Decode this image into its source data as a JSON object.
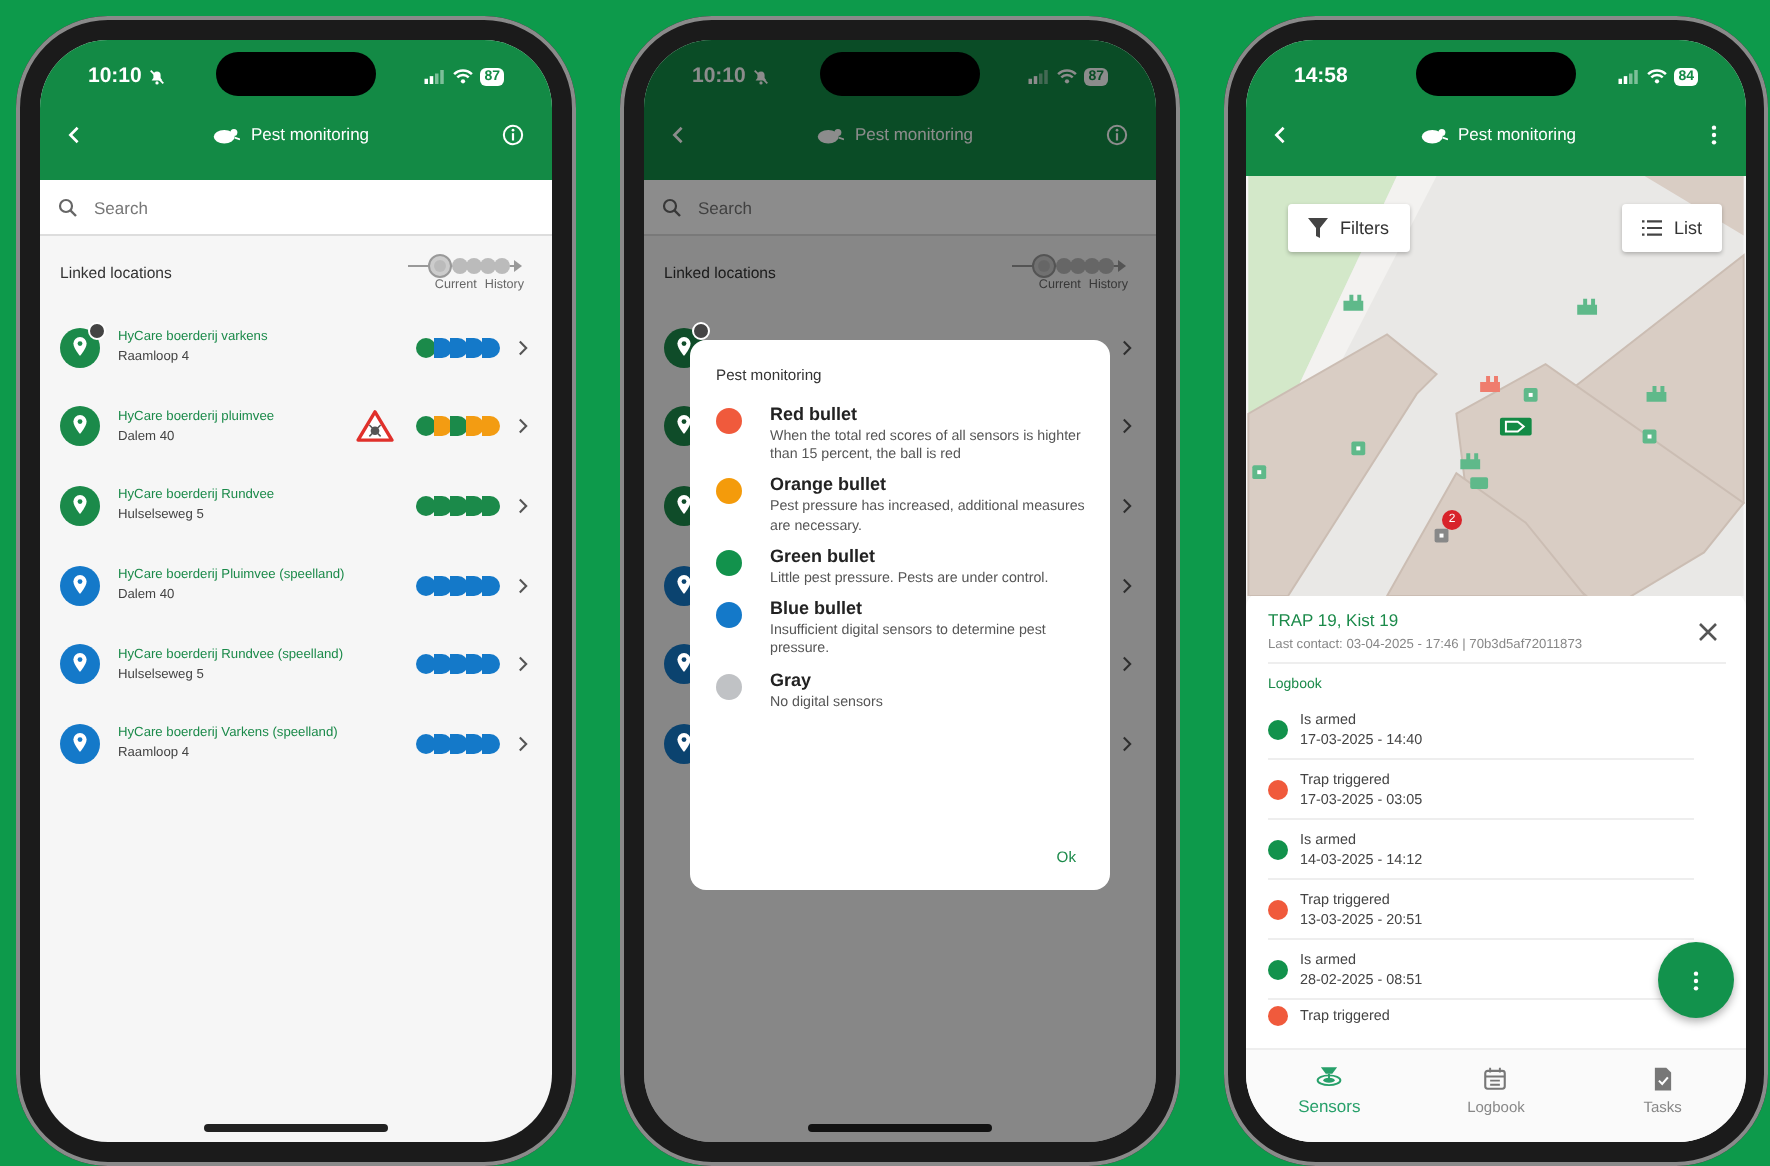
{
  "phones": [
    {
      "kind": "list",
      "status": {
        "time": "10:10",
        "silent": true,
        "battery": "87"
      },
      "header": {
        "title": "Pest monitoring",
        "kind": "info"
      },
      "search": {
        "placeholder": "Search"
      },
      "section": {
        "title": "Linked locations",
        "legend": [
          "Current",
          "History"
        ]
      },
      "locations": [
        {
          "name": "HyCare boerderij varkens",
          "address": "Raamloop 4",
          "color": "#1b8a4a",
          "badge": true,
          "warning": false,
          "bullets": [
            {
              "color": "#1b8a4a"
            },
            {
              "color": "#1479c9"
            },
            {
              "color": "#1479c9"
            },
            {
              "color": "#1479c9"
            },
            {
              "color": "#1479c9"
            }
          ]
        },
        {
          "name": "HyCare boerderij pluimvee",
          "address": "Dalem 40",
          "color": "#1b8a4a",
          "badge": false,
          "warning": true,
          "bullets": [
            {
              "color": "#1b8a4a"
            },
            {
              "color": "#f39c12"
            },
            {
              "color": "#1b8a4a"
            },
            {
              "color": "#f39c12"
            },
            {
              "color": "#f39c12"
            }
          ]
        },
        {
          "name": "HyCare boerderij Rundvee",
          "address": "Hulselseweg 5",
          "color": "#1b8a4a",
          "badge": false,
          "warning": false,
          "bullets": [
            {
              "color": "#1b8a4a"
            },
            {
              "color": "#1b8a4a"
            },
            {
              "color": "#1b8a4a"
            },
            {
              "color": "#1b8a4a"
            },
            {
              "color": "#1b8a4a"
            }
          ]
        },
        {
          "name": "HyCare boerderij Pluimvee (speelland)",
          "address": "Dalem 40",
          "color": "#1479c9",
          "badge": false,
          "warning": false,
          "bullets": [
            {
              "color": "#1479c9"
            },
            {
              "color": "#1479c9"
            },
            {
              "color": "#1479c9"
            },
            {
              "color": "#1479c9"
            },
            {
              "color": "#1479c9"
            }
          ]
        },
        {
          "name": "HyCare boerderij Rundvee (speelland)",
          "address": "Hulselseweg 5",
          "color": "#1479c9",
          "badge": false,
          "warning": false,
          "bullets": [
            {
              "color": "#1479c9"
            },
            {
              "color": "#1479c9"
            },
            {
              "color": "#1479c9"
            },
            {
              "color": "#1479c9"
            },
            {
              "color": "#1479c9"
            }
          ]
        },
        {
          "name": "HyCare boerderij Varkens (speelland)",
          "address": "Raamloop 4",
          "color": "#1479c9",
          "badge": false,
          "warning": false,
          "bullets": [
            {
              "color": "#1479c9"
            },
            {
              "color": "#1479c9"
            },
            {
              "color": "#1479c9"
            },
            {
              "color": "#1479c9"
            },
            {
              "color": "#1479c9"
            }
          ]
        }
      ]
    },
    {
      "kind": "dialog",
      "status": {
        "time": "10:10",
        "silent": true,
        "battery": "87"
      },
      "header": {
        "title": "Pest monitoring",
        "kind": "info"
      },
      "search": {
        "placeholder": "Search"
      },
      "section": {
        "title": "Linked locations",
        "legend": [
          "Current",
          "History"
        ]
      },
      "background_rows": [
        {
          "color": "#0f4c29",
          "badge": true
        },
        {
          "color": "#0f4c29",
          "badge": false
        },
        {
          "color": "#0f4c29",
          "badge": false
        },
        {
          "color": "#0b436f",
          "badge": false
        },
        {
          "color": "#0b436f",
          "badge": false
        },
        {
          "color": "#0b436f",
          "badge": false
        }
      ],
      "dialog": {
        "title": "Pest monitoring",
        "items": [
          {
            "title": "Red bullet",
            "text": "When the total red scores of all sensors is highter than 15 percent, the ball is red",
            "color": "#f05a3c"
          },
          {
            "title": "Orange bullet",
            "text": "Pest pressure has increased, additional measures are necessary.",
            "color": "#f49b0b"
          },
          {
            "title": "Green bullet",
            "text": "Little pest pressure. Pests are under control.",
            "color": "#12924c"
          },
          {
            "title": "Blue bullet",
            "text": "Insufficient digital sensors to determine pest pressure.",
            "color": "#1479c9"
          },
          {
            "title": "Gray",
            "text": "No digital sensors",
            "color": "#c0c2c5"
          }
        ],
        "button": "Ok"
      }
    },
    {
      "kind": "map",
      "status": {
        "time": "14:58",
        "silent": false,
        "battery": "84"
      },
      "header": {
        "title": "Pest monitoring",
        "kind": "more"
      },
      "map": {
        "buttons": [
          {
            "label": "Filters",
            "kind": "filter"
          },
          {
            "label": "List",
            "kind": "list"
          }
        ],
        "cluster_count": "2"
      },
      "sheet": {
        "title": "TRAP 19, Kist 19",
        "subtitle": "Last contact: 03-04-2025 - 17:46 | 70b3d5af72011873",
        "section": "Logbook",
        "entries": [
          {
            "event": "Is armed",
            "time": "17-03-2025 - 14:40",
            "color": "#12924c"
          },
          {
            "event": "Trap triggered",
            "time": "17-03-2025 - 03:05",
            "color": "#f05a3c"
          },
          {
            "event": "Is armed",
            "time": "14-03-2025 - 14:12",
            "color": "#12924c"
          },
          {
            "event": "Trap triggered",
            "time": "13-03-2025 - 20:51",
            "color": "#f05a3c"
          },
          {
            "event": "Is armed",
            "time": "28-02-2025 - 08:51",
            "color": "#12924c"
          },
          {
            "event": "Trap triggered",
            "color": "#f05a3c"
          }
        ]
      },
      "nav": [
        {
          "label": "Sensors",
          "kind": "sensors",
          "selected": true
        },
        {
          "label": "Logbook",
          "kind": "logbook",
          "selected": false
        },
        {
          "label": "Tasks",
          "kind": "tasks",
          "selected": false
        }
      ]
    }
  ]
}
